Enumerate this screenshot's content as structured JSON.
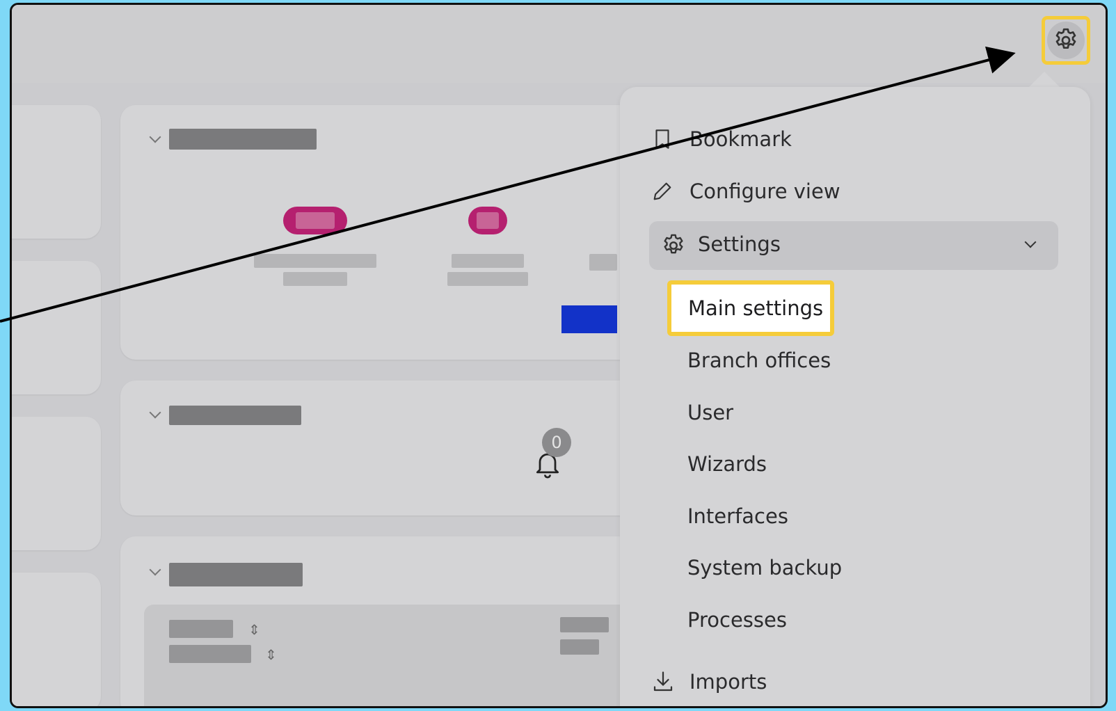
{
  "colors": {
    "highlight": "#f5cc3a",
    "background": "#7fd8f7",
    "badge_pink": "#b5206f",
    "accent_blue": "#1232c8"
  },
  "header": {
    "settings_icon": "gear-icon"
  },
  "notifications": {
    "count": "0",
    "icon": "bell-icon"
  },
  "menu": {
    "bookmark": {
      "label": "Bookmark",
      "icon": "bookmark-icon"
    },
    "configure_view": {
      "label": "Configure view",
      "icon": "pencil-icon"
    },
    "settings": {
      "label": "Settings",
      "icon": "gear-icon",
      "expanded": true,
      "items": [
        "Main settings",
        "Branch offices",
        "User",
        "Wizards",
        "Interfaces",
        "System backup",
        "Processes"
      ]
    },
    "imports": {
      "label": "Imports",
      "icon": "download-icon"
    }
  }
}
